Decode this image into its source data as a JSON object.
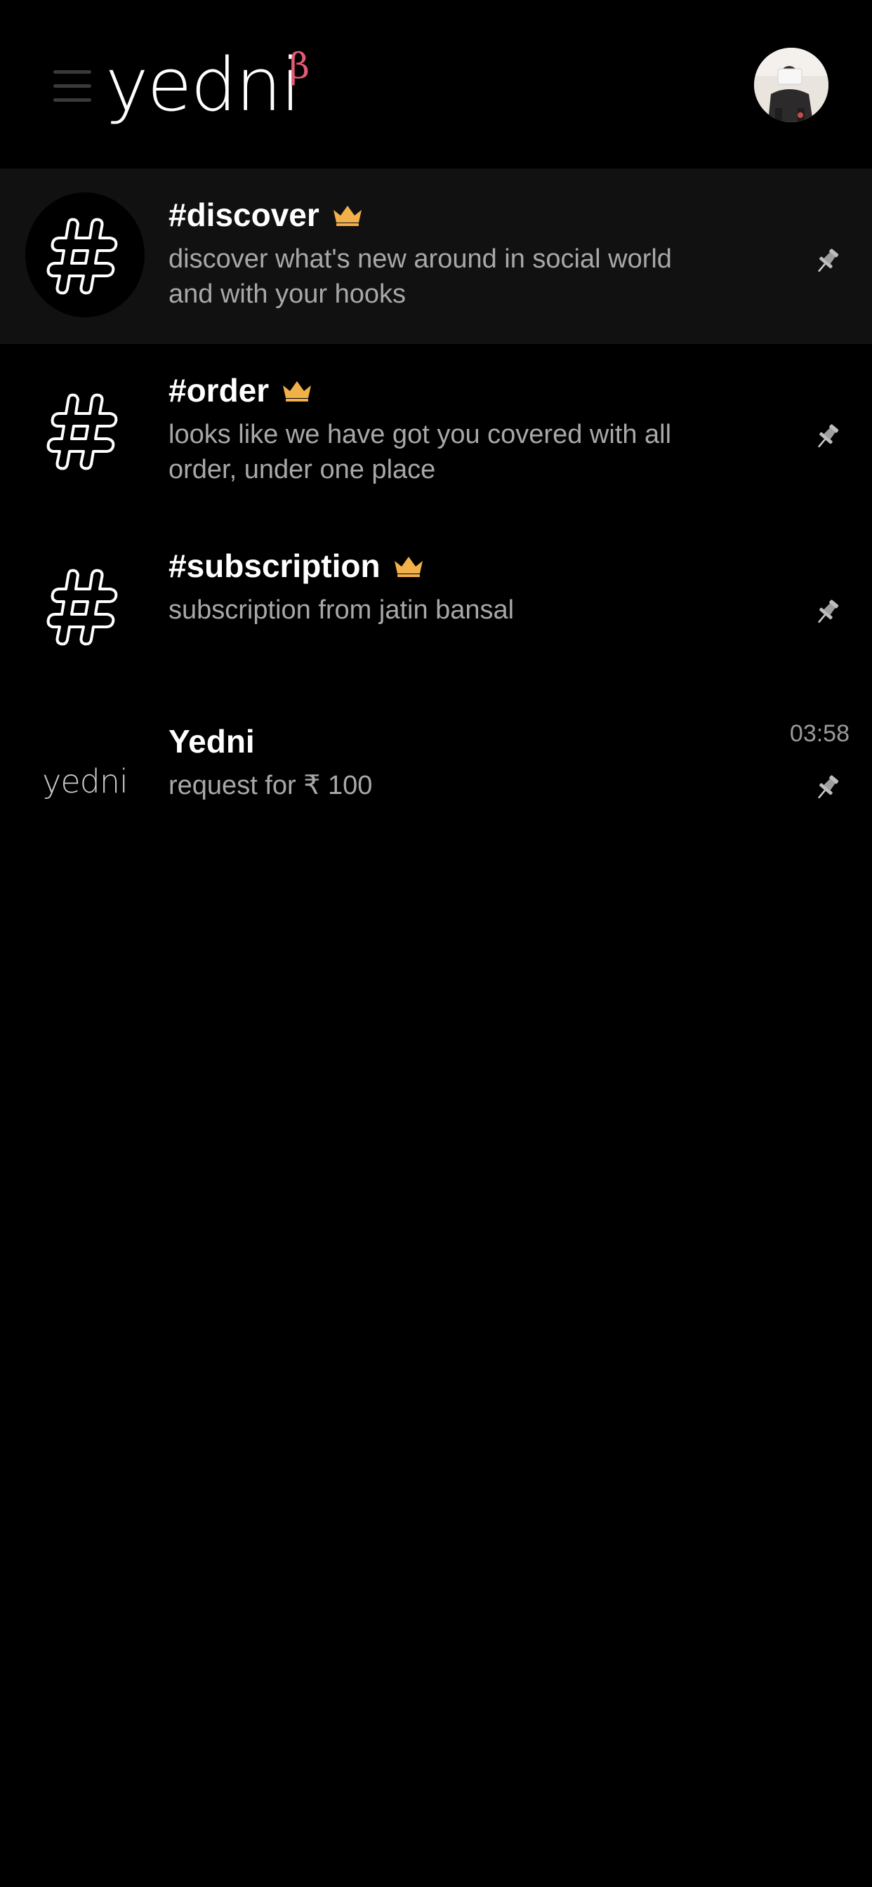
{
  "header": {
    "logo_text": "yedni",
    "beta_mark": "β",
    "menu_icon": "hamburger-menu-icon",
    "avatar_icon": "user-avatar"
  },
  "colors": {
    "background": "#000000",
    "active_row": "#111111",
    "beta_accent": "#e35b78",
    "crown": "#f2b04a",
    "subtitle": "#a8a8a8",
    "pin": "#bdbdbd"
  },
  "conversations": [
    {
      "title": "#discover",
      "subtitle": "discover what's new around in social world and with your hooks",
      "has_crown": true,
      "icon": "hashtag-face-icon",
      "pinned": true,
      "active": true
    },
    {
      "title": "#order",
      "subtitle": "looks like we have got you covered with all order, under one place",
      "has_crown": true,
      "icon": "hashtag-face-icon",
      "pinned": true,
      "active": false
    },
    {
      "title": "#subscription",
      "subtitle": "subscription from jatin bansal",
      "has_crown": true,
      "icon": "hashtag-face-icon",
      "pinned": true,
      "active": false
    },
    {
      "title": "Yedni",
      "subtitle": "request for ₹ 100",
      "avatar_text": "yedni",
      "time": "03:58",
      "has_crown": false,
      "icon": "yedni-logo",
      "pinned": true,
      "active": false
    }
  ]
}
